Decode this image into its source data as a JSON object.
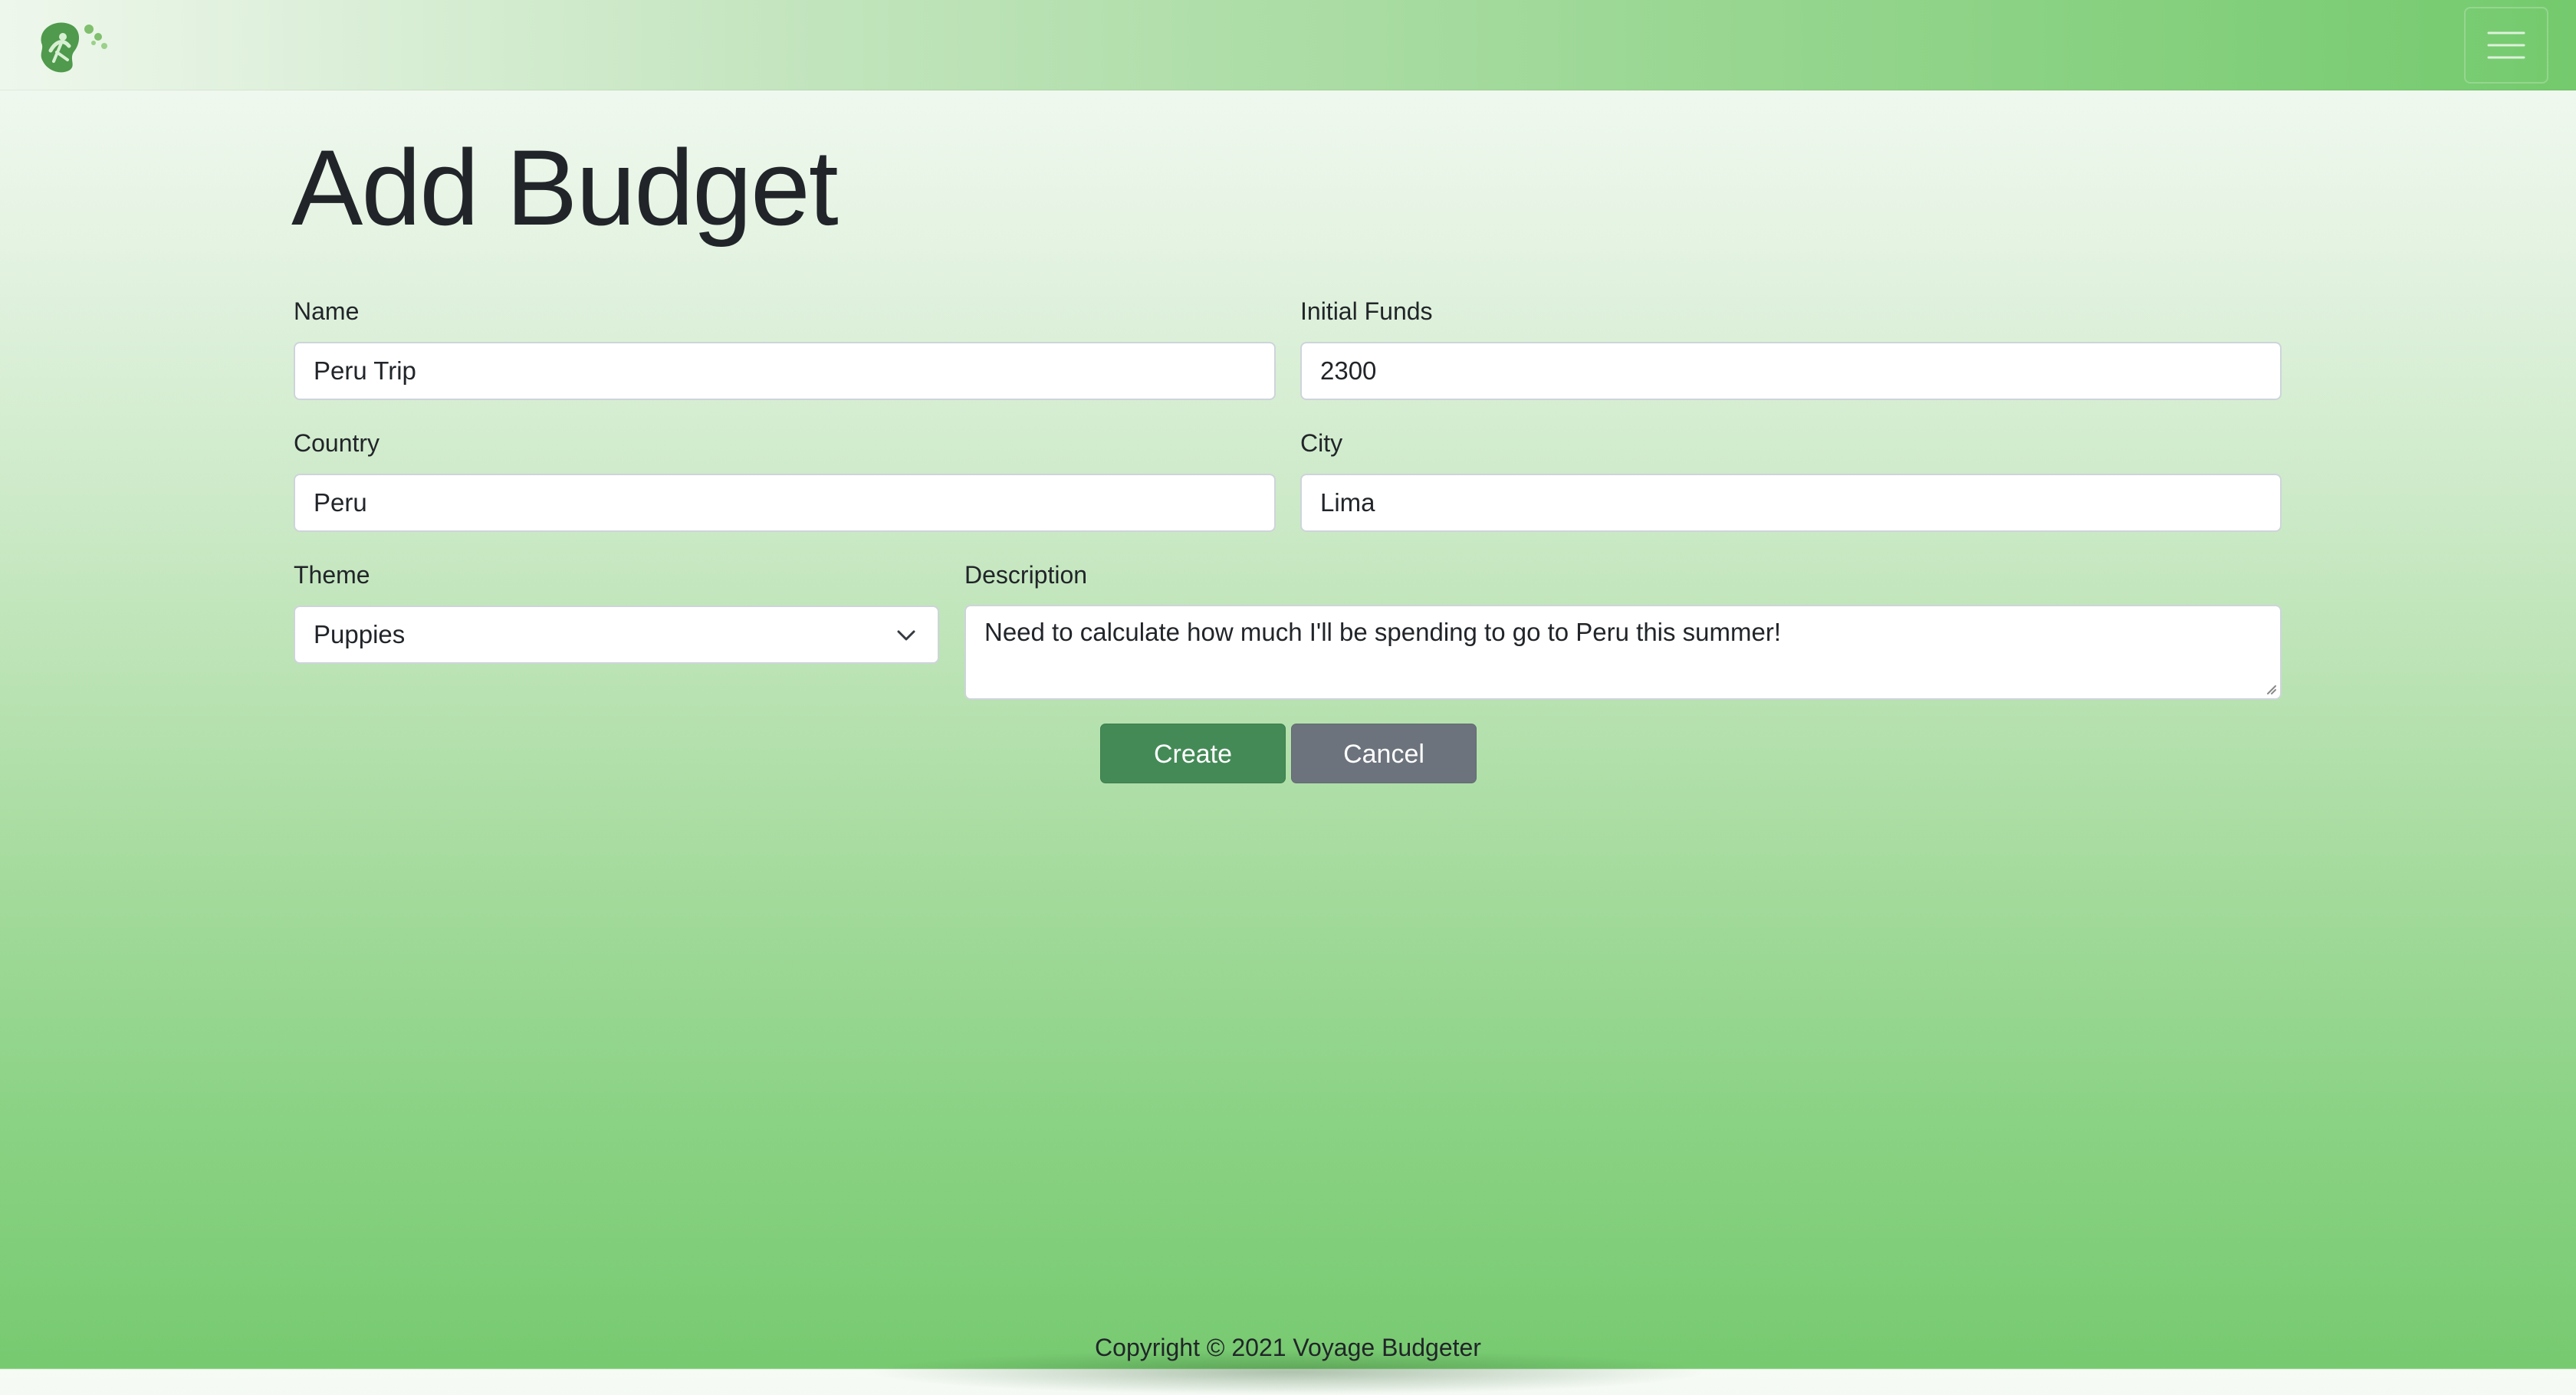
{
  "navbar": {
    "logo_icon": "leaf-traveler-logo-icon",
    "menu_icon": "hamburger-menu-icon",
    "accent": "#74ca6d"
  },
  "page": {
    "title": "Add Budget"
  },
  "form": {
    "name": {
      "label": "Name",
      "value": "Peru Trip"
    },
    "initial_funds": {
      "label": "Initial Funds",
      "value": "2300"
    },
    "country": {
      "label": "Country",
      "value": "Peru"
    },
    "city": {
      "label": "City",
      "value": "Lima"
    },
    "theme": {
      "label": "Theme",
      "value": "Puppies"
    },
    "description": {
      "label": "Description",
      "value": "Need to calculate how much I'll be spending to go to Peru this summer!"
    }
  },
  "buttons": {
    "create": "Create",
    "cancel": "Cancel",
    "create_color": "#448a57",
    "cancel_color": "#6c737d"
  },
  "footer": {
    "copyright": "Copyright © 2021 Voyage Budgeter"
  }
}
